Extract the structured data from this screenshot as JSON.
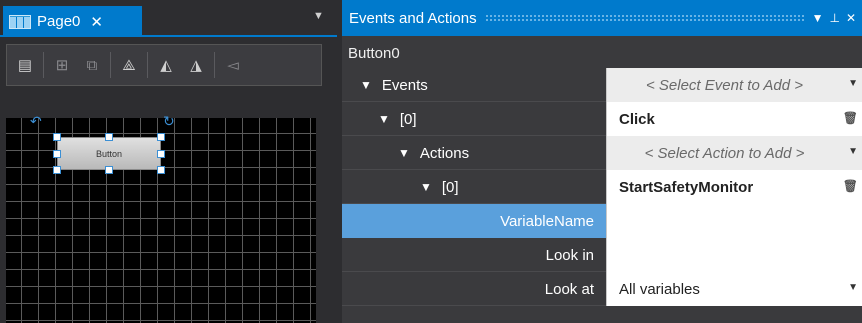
{
  "designer": {
    "tab_label": "Page0",
    "tab_close": "✕",
    "dropdown_glyph": "▼",
    "toolbar_icons": [
      "properties-icon",
      "align-icon",
      "group-icon",
      "rotate-icon",
      "flip-icon",
      "flip-icon-2",
      "distribute-icon"
    ],
    "widget_label": "Button"
  },
  "panel": {
    "title": "Events and Actions",
    "controls": [
      "▼",
      "⊥",
      "✕"
    ],
    "object_name": "Button0"
  },
  "grid": {
    "events_label": "Events",
    "events_select": "< Select Event to Add >",
    "event0_label": "[0]",
    "event0_value": "Click",
    "actions_label": "Actions",
    "actions_select": "< Select Action to Add >",
    "action0_label": "[0]",
    "action0_value": "StartSafetyMonitor",
    "variable_name_label": "VariableName",
    "variable_name_value": "",
    "look_in_label": "Look in",
    "look_in_value": "",
    "look_at_label": "Look at",
    "look_at_value": "All variables"
  },
  "colors": {
    "accent": "#007acc",
    "selected_row": "#5aa0dc",
    "handle": "#3b8fd4"
  }
}
